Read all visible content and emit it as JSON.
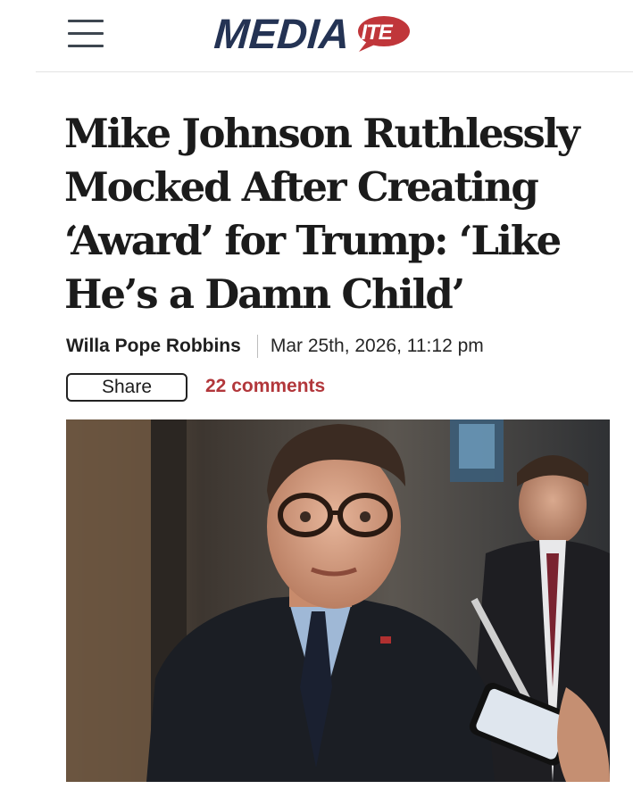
{
  "header": {
    "logo_main": "MEDIA",
    "logo_bubble": "ITE",
    "brand_color": "#243354",
    "accent_color": "#c0363a",
    "menu_icon": "hamburger-menu-icon"
  },
  "article": {
    "headline": "Mike Johnson Ruthlessly Mocked After Creating ‘Award’ for Trump: ‘Like He’s a Damn Child’",
    "author": "Willa Pope Robbins",
    "date": "Mar 25th, 2026, 11:12 pm",
    "share_label": "Share",
    "comments_label": "22 comments",
    "comments_color": "#b2373b"
  }
}
